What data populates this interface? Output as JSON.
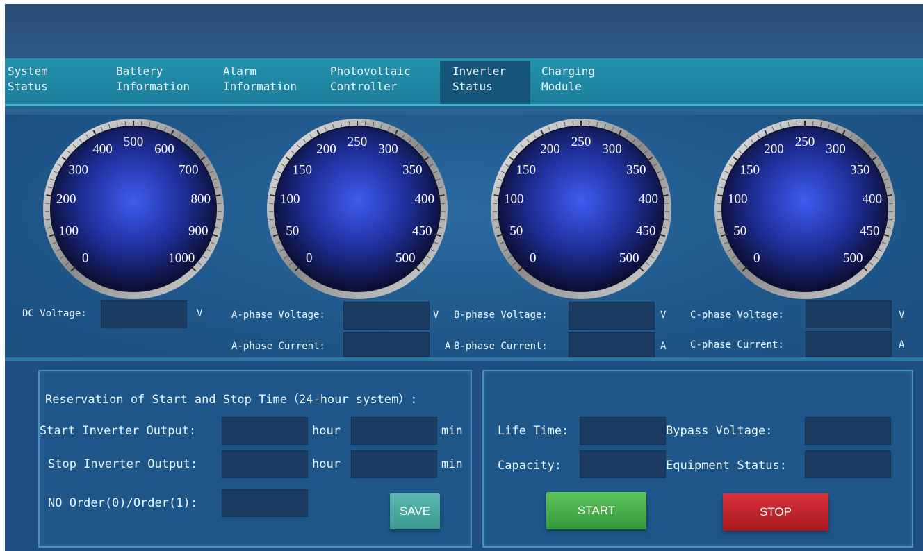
{
  "tabs": [
    {
      "line1": "System",
      "line2": "Status",
      "active": false
    },
    {
      "line1": "Battery",
      "line2": "Information",
      "active": false
    },
    {
      "line1": "Alarm",
      "line2": "Information",
      "active": false
    },
    {
      "line1": "Photovoltaic",
      "line2": "Controller",
      "active": false
    },
    {
      "line1": "Inverter",
      "line2": "Status",
      "active": true
    },
    {
      "line1": "Charging",
      "line2": "Module",
      "active": false
    }
  ],
  "gauges": [
    {
      "ticks": [
        "0",
        "100",
        "200",
        "300",
        "400",
        "500",
        "600",
        "700",
        "800",
        "900",
        "1000"
      ]
    },
    {
      "ticks": [
        "0",
        "50",
        "100",
        "150",
        "200",
        "250",
        "300",
        "350",
        "400",
        "450",
        "500"
      ]
    },
    {
      "ticks": [
        "0",
        "50",
        "100",
        "150",
        "200",
        "250",
        "300",
        "350",
        "400",
        "450",
        "500"
      ]
    },
    {
      "ticks": [
        "0",
        "50",
        "100",
        "150",
        "200",
        "250",
        "300",
        "350",
        "400",
        "450",
        "500"
      ]
    }
  ],
  "readings": {
    "dc_voltage_label": "DC Voltage:",
    "a_voltage_label": "A-phase Voltage:",
    "a_current_label": "A-phase Current:",
    "b_voltage_label": "B-phase Voltage:",
    "b_current_label": "B-phase Current:",
    "c_voltage_label": "C-phase Voltage:",
    "c_current_label": "C-phase Current:",
    "unit_v": "V",
    "unit_a": "A"
  },
  "reservation": {
    "title": "Reservation of Start and Stop Time（24-hour system）:",
    "start_label": "Start Inverter Output:",
    "stop_label": "Stop Inverter Output:",
    "order_label": "NO Order(0)/Order(1):",
    "hour_unit": "hour",
    "min_unit": "min",
    "save_button": "SAVE"
  },
  "status": {
    "life_time_label": "Life Time:",
    "capacity_label": "Capacity:",
    "bypass_voltage_label": "Bypass Voltage:",
    "equipment_status_label": "Equipment Status:",
    "start_button": "START",
    "stop_button": "STOP"
  },
  "colors": {
    "background": "#1f4f82",
    "tab_bar": "#1c7f9c",
    "save": "#3d9990",
    "start": "#34983a",
    "stop": "#a81820"
  }
}
